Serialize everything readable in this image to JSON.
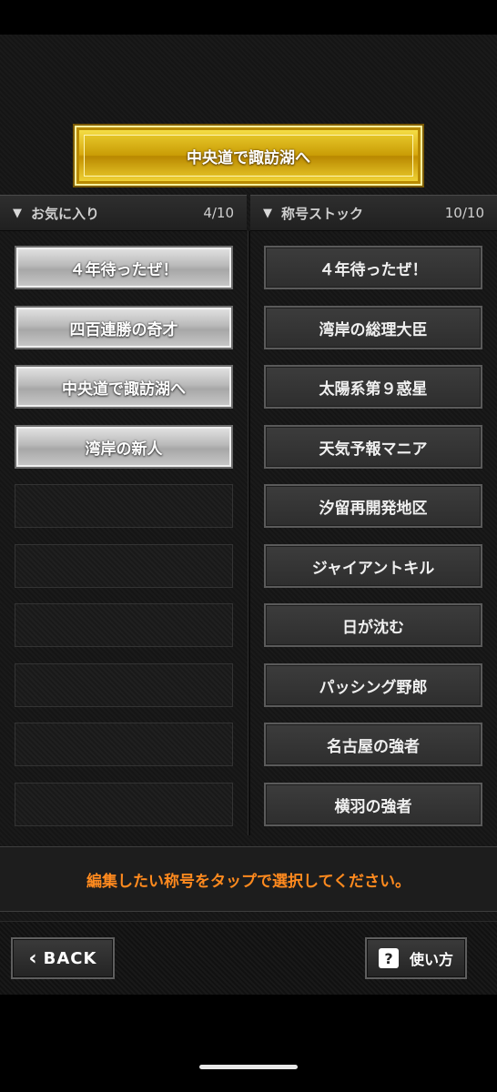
{
  "selected_title": "中央道で諏訪湖へ",
  "favorites": {
    "header": "お気に入り",
    "count": "4/10",
    "items": [
      "４年待ったぜ！",
      "四百連勝の奇才",
      "中央道で諏訪湖へ",
      "湾岸の新人"
    ]
  },
  "stock": {
    "header": "称号ストック",
    "count": "10/10",
    "items": [
      "４年待ったぜ！",
      "湾岸の総理大臣",
      "太陽系第９惑星",
      "天気予報マニア",
      "汐留再開発地区",
      "ジャイアントキル",
      "日が沈む",
      "パッシング野郎",
      "名古屋の強者",
      "横羽の強者"
    ]
  },
  "instruction": "編集したい称号をタップで選択してください。",
  "buttons": {
    "back": "BACK",
    "help": "使い方",
    "help_icon_glyph": "?"
  },
  "icons": {
    "header_triangle": "triangle-down-icon",
    "back": "chevron-left-icon",
    "help": "question-icon"
  },
  "colors": {
    "instruction_text": "#ff8a1e",
    "banner_gold": "#d8a910"
  }
}
